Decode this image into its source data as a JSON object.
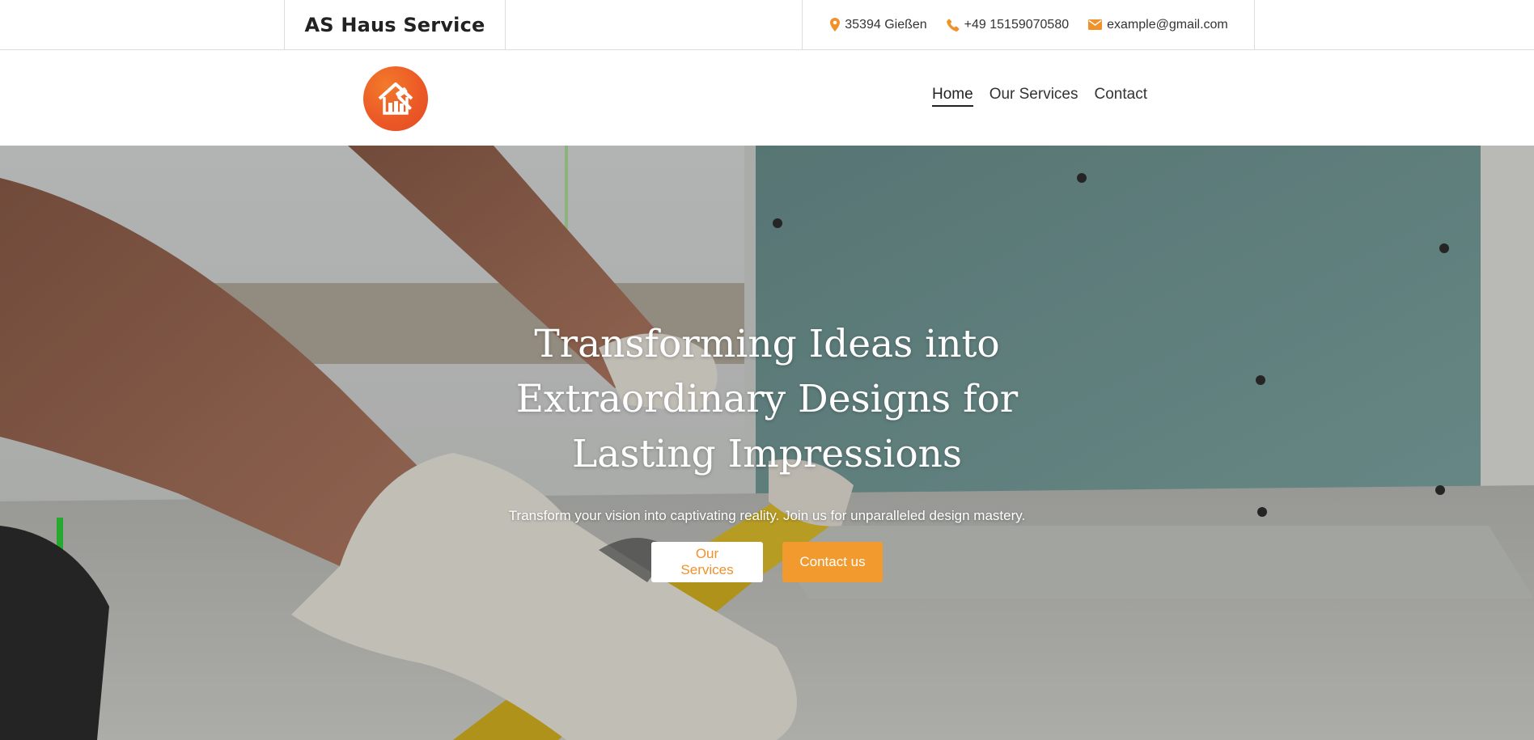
{
  "topbar": {
    "brand": "AS Haus Service",
    "location": {
      "icon": "map-pin-icon",
      "text": "35394 Gießen"
    },
    "phone": {
      "icon": "phone-icon",
      "text": "+49 15159070580"
    },
    "email": {
      "icon": "envelope-icon",
      "text": "example@gmail.com"
    }
  },
  "nav": {
    "logo_icon": "house-hammer-logo-icon",
    "links": [
      {
        "label": "Home",
        "active": true
      },
      {
        "label": "Our Services",
        "active": false
      },
      {
        "label": "Contact",
        "active": false
      }
    ]
  },
  "hero": {
    "title": "Transforming Ideas into Extraordinary Designs for Lasting Impressions",
    "subtitle": "Transform your vision into captivating reality. Join us for unparalleled design mastery.",
    "buttons": {
      "services": "Our Services",
      "contact": "Contact us"
    }
  },
  "colors": {
    "accent": "#f29a2e",
    "icon_accent": "#f0912a",
    "logo": "#ec5a27",
    "text_dark": "#222222"
  }
}
